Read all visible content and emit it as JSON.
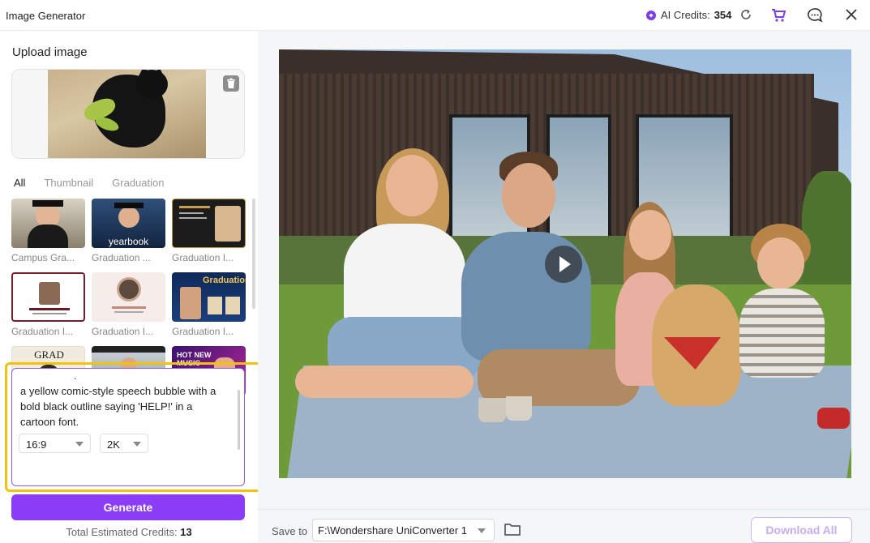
{
  "window": {
    "title": "Image Generator"
  },
  "header": {
    "credits_label": "AI Credits:",
    "credits_value": "354"
  },
  "upload": {
    "label": "Upload image"
  },
  "tabs": [
    {
      "label": "All",
      "active": true
    },
    {
      "label": "Thumbnail",
      "active": false
    },
    {
      "label": "Graduation",
      "active": false
    }
  ],
  "templates": [
    {
      "label": "Campus Gra...",
      "card_text": ""
    },
    {
      "label": "Graduation ...",
      "card_text": "yearbook"
    },
    {
      "label": "Graduation I...",
      "card_text": ""
    },
    {
      "label": "Graduation I...",
      "card_text": ""
    },
    {
      "label": "Graduation I...",
      "card_text": ""
    },
    {
      "label": "Graduation I...",
      "card_text": "Graduation"
    },
    {
      "label": "",
      "card_text": "GRAD"
    },
    {
      "label": "",
      "card_text": ""
    },
    {
      "label": "",
      "card_text": "HOT NEW MUSIC"
    }
  ],
  "prompt": {
    "dot": ".",
    "text": "a yellow comic-style speech bubble with a bold black outline saying 'HELP!' in a cartoon font.",
    "ratio": "16:9",
    "resolution": "2K"
  },
  "actions": {
    "generate_label": "Generate",
    "estimate_label": "Total Estimated Credits:",
    "estimate_value": "13"
  },
  "footer": {
    "save_to_label": "Save to",
    "path_value": "F:\\Wondershare UniConverter 1",
    "download_all_label": "Download All"
  },
  "colors": {
    "accent": "#8a3cf7",
    "highlight": "#f3c20a"
  }
}
